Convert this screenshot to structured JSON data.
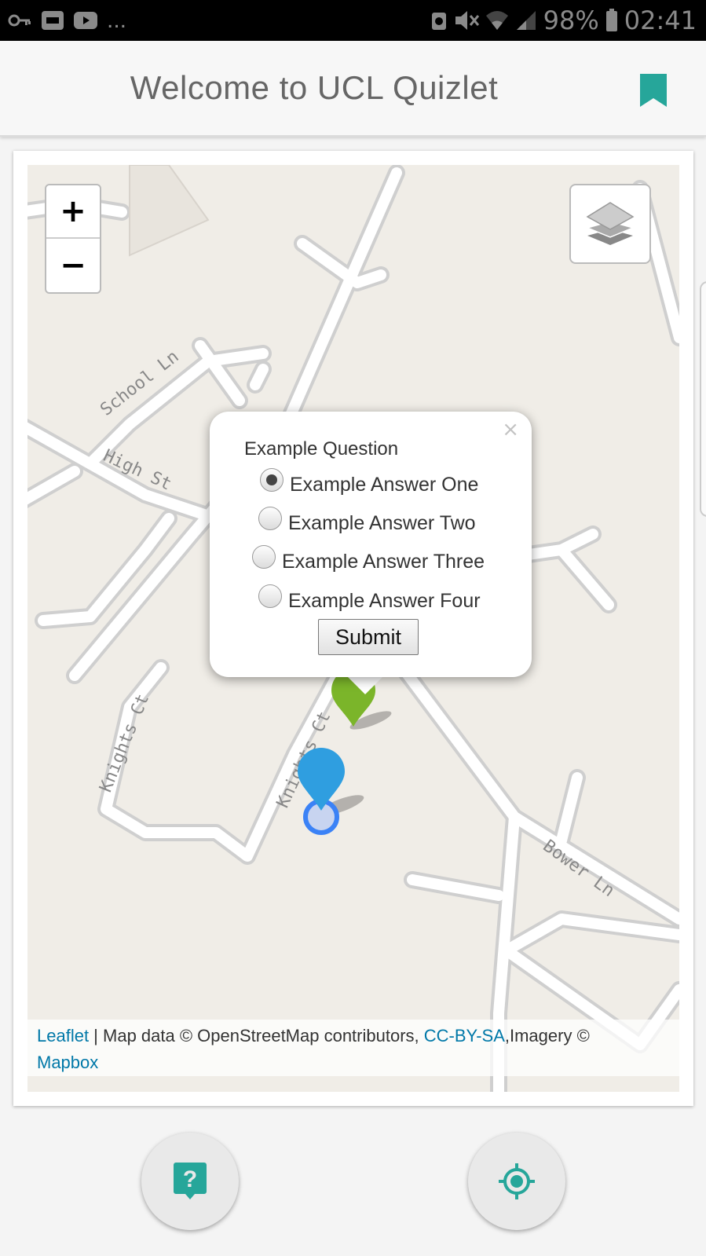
{
  "status_bar": {
    "dots": "...",
    "battery": "98%",
    "time": "02:41"
  },
  "app_bar": {
    "title": "Welcome to UCL Quizlet"
  },
  "map": {
    "zoom_in": "+",
    "zoom_out": "−",
    "street_labels": [
      "School Ln",
      "High St",
      "Knights Ct",
      "Knights Ct",
      "Bower Ln"
    ],
    "attribution": {
      "leaflet": "Leaflet",
      "sep": " | Map data © OpenStreetMap contributors, ",
      "license": "CC-BY-SA",
      "imagery": ",Imagery © ",
      "mapbox": "Mapbox"
    }
  },
  "popup": {
    "close": "×",
    "question": "Example Question",
    "answers": [
      {
        "label": "Example Answer One",
        "checked": true
      },
      {
        "label": "Example Answer Two",
        "checked": false
      },
      {
        "label": "Example Answer Three",
        "checked": false
      },
      {
        "label": "Example Answer Four",
        "checked": false
      }
    ],
    "submit": "Submit"
  },
  "colors": {
    "accent": "#26a69a",
    "quiz_marker": "#7bb52a",
    "user_marker": "#2f9ee0",
    "link": "#0078a8"
  }
}
